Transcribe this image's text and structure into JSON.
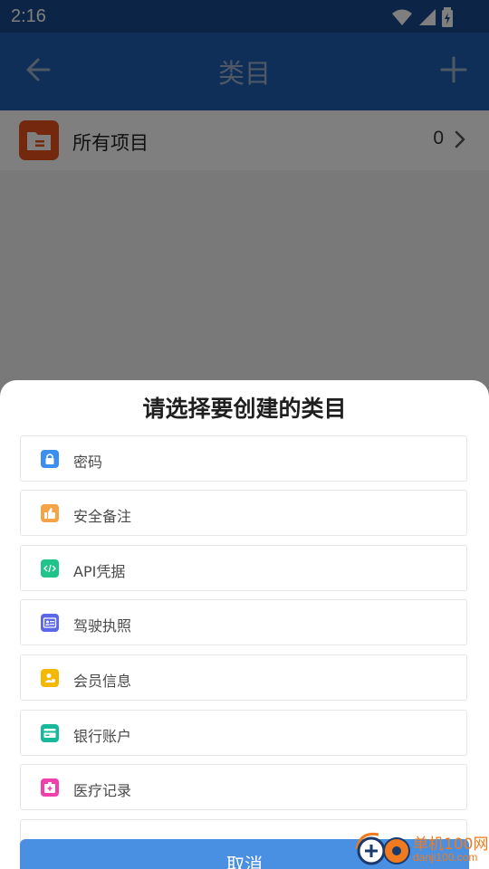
{
  "status_bar": {
    "time": "2:16"
  },
  "app_bar": {
    "title": "类目"
  },
  "all_items": {
    "label": "所有项目",
    "count": "0"
  },
  "sheet": {
    "title": "请选择要创建的类目",
    "options": [
      {
        "label": "密码",
        "icon": "lock-icon",
        "color": "#3b8ff0"
      },
      {
        "label": "安全备注",
        "icon": "thumbs-up-icon",
        "color": "#f5a445"
      },
      {
        "label": "API凭据",
        "icon": "code-icon",
        "color": "#1fc48a"
      },
      {
        "label": "驾驶执照",
        "icon": "id-card-icon",
        "color": "#5b66e8"
      },
      {
        "label": "会员信息",
        "icon": "member-icon",
        "color": "#f5b800"
      },
      {
        "label": "银行账户",
        "icon": "bank-card-icon",
        "color": "#18b99a"
      },
      {
        "label": "医疗记录",
        "icon": "medical-kit-icon",
        "color": "#f23fae"
      }
    ],
    "cancel_label": "取消"
  },
  "watermark": {
    "name": "单机100网",
    "url": "danji100.com"
  },
  "colors": {
    "app_bar": "#1e5fb3",
    "status_bar": "#184a8c",
    "cancel_button": "#4a90e2",
    "folder": "#e8531f"
  }
}
